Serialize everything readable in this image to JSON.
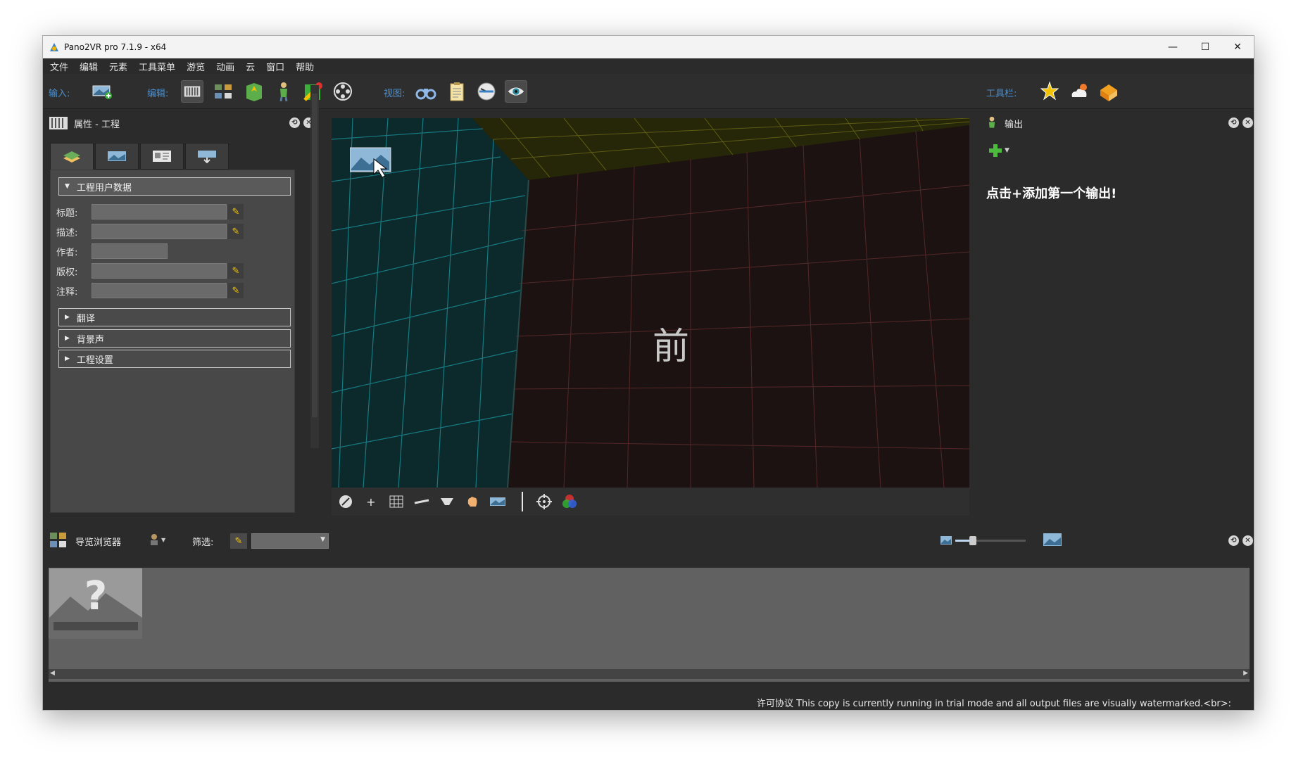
{
  "window": {
    "title": "Pano2VR pro 7.1.9 - x64",
    "controls": [
      "minimize",
      "maximize",
      "close"
    ]
  },
  "menubar": {
    "items": [
      "文件",
      "编辑",
      "元素",
      "工具菜单",
      "游览",
      "动画",
      "云",
      "窗口",
      "帮助"
    ]
  },
  "toolbar": {
    "input_label": "输入:",
    "edit_label": "编辑:",
    "view_label": "视图:",
    "toolbar_label": "工具栏:"
  },
  "left_panel": {
    "title": "属性 - 工程",
    "section_userdata": "工程用户数据",
    "fields": {
      "title_label": "标题:",
      "desc_label": "描述:",
      "author_label": "作者:",
      "copyright_label": "版权:",
      "comment_label": "注释:"
    },
    "sections": [
      "翻译",
      "背景声",
      "工程设置"
    ]
  },
  "viewport": {
    "face_label": "前",
    "colors": {
      "left_wall": "#0c2a2c",
      "ceiling": "#2a2a0c",
      "front": "#1d1212",
      "grid_left": "#1aa7b0",
      "grid_front": "#5a2a2a",
      "grid_top": "#7a7a1a"
    }
  },
  "right_panel": {
    "title": "输出",
    "empty_message": "点击+添加第一个输出!"
  },
  "browser": {
    "title": "导览浏览器",
    "filter_label": "筛选:"
  },
  "status": {
    "text": "许可协议 This copy is currently running in trial mode and all output files are visually watermarked.<br>:"
  }
}
